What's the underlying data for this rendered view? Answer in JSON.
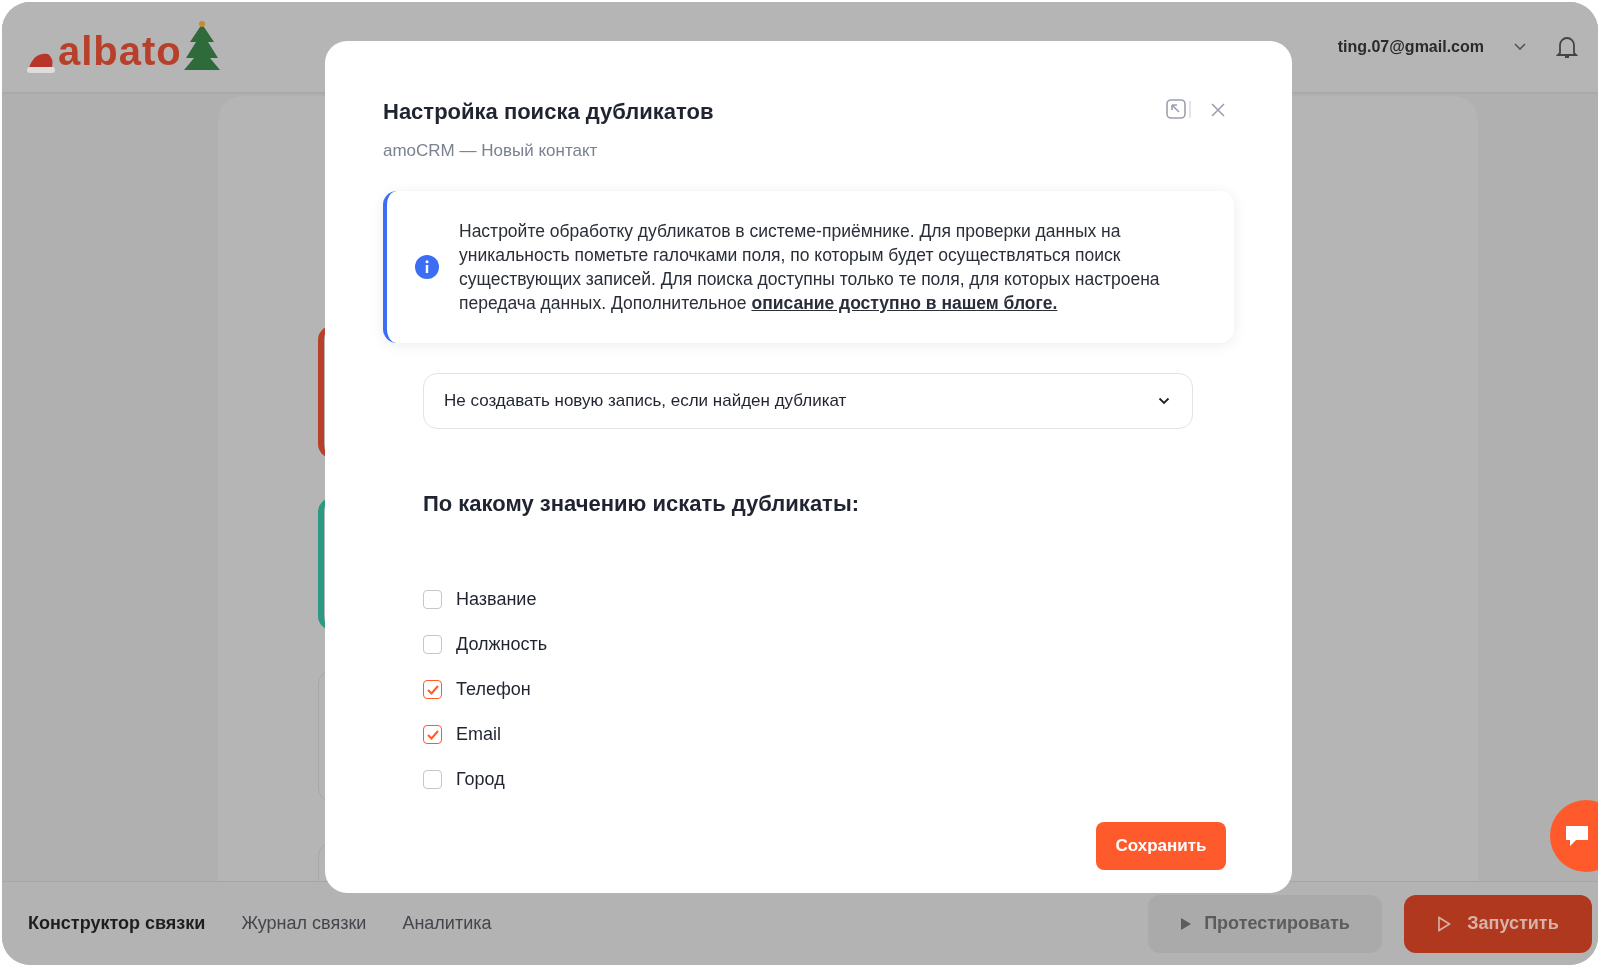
{
  "header": {
    "logo": "albato",
    "account": "ting.07@gmail.com"
  },
  "bottom_bar": {
    "tabs": [
      {
        "label": "Конструктор связки",
        "selected": true
      },
      {
        "label": "Журнал связки",
        "selected": false
      },
      {
        "label": "Аналитика",
        "selected": false
      }
    ],
    "test_button": "Протестировать",
    "run_button": "Запустить"
  },
  "modal": {
    "title": "Настройка поиска дубликатов",
    "subtitle": "amoCRM — Новый контакт",
    "info": {
      "text": "Настройте обработку дубликатов в системе-приёмнике. Для проверки данных на уникальность пометьте галочками поля, по которым будет осуществляться поиск существующих записей. Для поиска доступны только те поля, для которых настроена передача данных. Дополнительное ",
      "link": "описание доступно в нашем блоге."
    },
    "mode_select": {
      "value": "Не создавать новую запись, если найден дубликат"
    },
    "fields_heading": "По какому значению искать дубликаты:",
    "fields": [
      {
        "label": "Название",
        "checked": false
      },
      {
        "label": "Должность",
        "checked": false
      },
      {
        "label": "Телефон",
        "checked": true
      },
      {
        "label": "Email",
        "checked": true
      },
      {
        "label": "Город",
        "checked": false
      }
    ],
    "save_button": "Сохранить"
  }
}
